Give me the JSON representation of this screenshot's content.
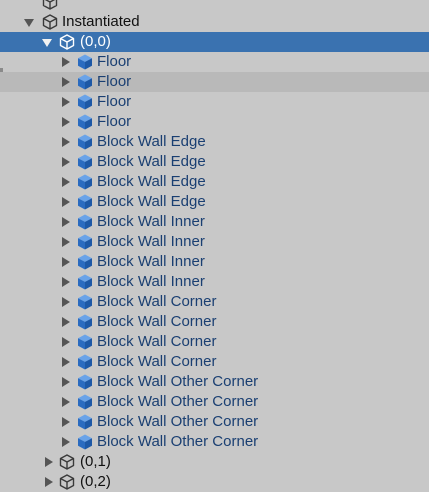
{
  "hierarchy": {
    "root": {
      "label": "Instantiated",
      "state": "expanded"
    },
    "selected_group": {
      "label": "(0,0)",
      "state": "expanded"
    },
    "children": [
      {
        "label": "Floor"
      },
      {
        "label": "Floor"
      },
      {
        "label": "Floor"
      },
      {
        "label": "Floor"
      },
      {
        "label": "Block Wall Edge"
      },
      {
        "label": "Block Wall Edge"
      },
      {
        "label": "Block Wall Edge"
      },
      {
        "label": "Block Wall Edge"
      },
      {
        "label": "Block Wall Inner"
      },
      {
        "label": "Block Wall Inner"
      },
      {
        "label": "Block Wall Inner"
      },
      {
        "label": "Block Wall Inner"
      },
      {
        "label": "Block Wall Corner"
      },
      {
        "label": "Block Wall Corner"
      },
      {
        "label": "Block Wall Corner"
      },
      {
        "label": "Block Wall Corner"
      },
      {
        "label": "Block Wall Other Corner"
      },
      {
        "label": "Block Wall Other Corner"
      },
      {
        "label": "Block Wall Other Corner"
      },
      {
        "label": "Block Wall Other Corner"
      }
    ],
    "siblings": [
      {
        "label": "(0,1)",
        "state": "collapsed"
      },
      {
        "label": "(0,2)",
        "state": "collapsed"
      }
    ]
  },
  "icons": {
    "prefab": "prefab-cube-icon",
    "gameobject": "gameobject-cube-icon"
  },
  "colors": {
    "background": "#c8c8c8",
    "selection": "#3a72b0",
    "hover_row": "#b9b9b9",
    "prefab_text": "#1a3f72",
    "prefab_icon": "#2a6bc0"
  }
}
